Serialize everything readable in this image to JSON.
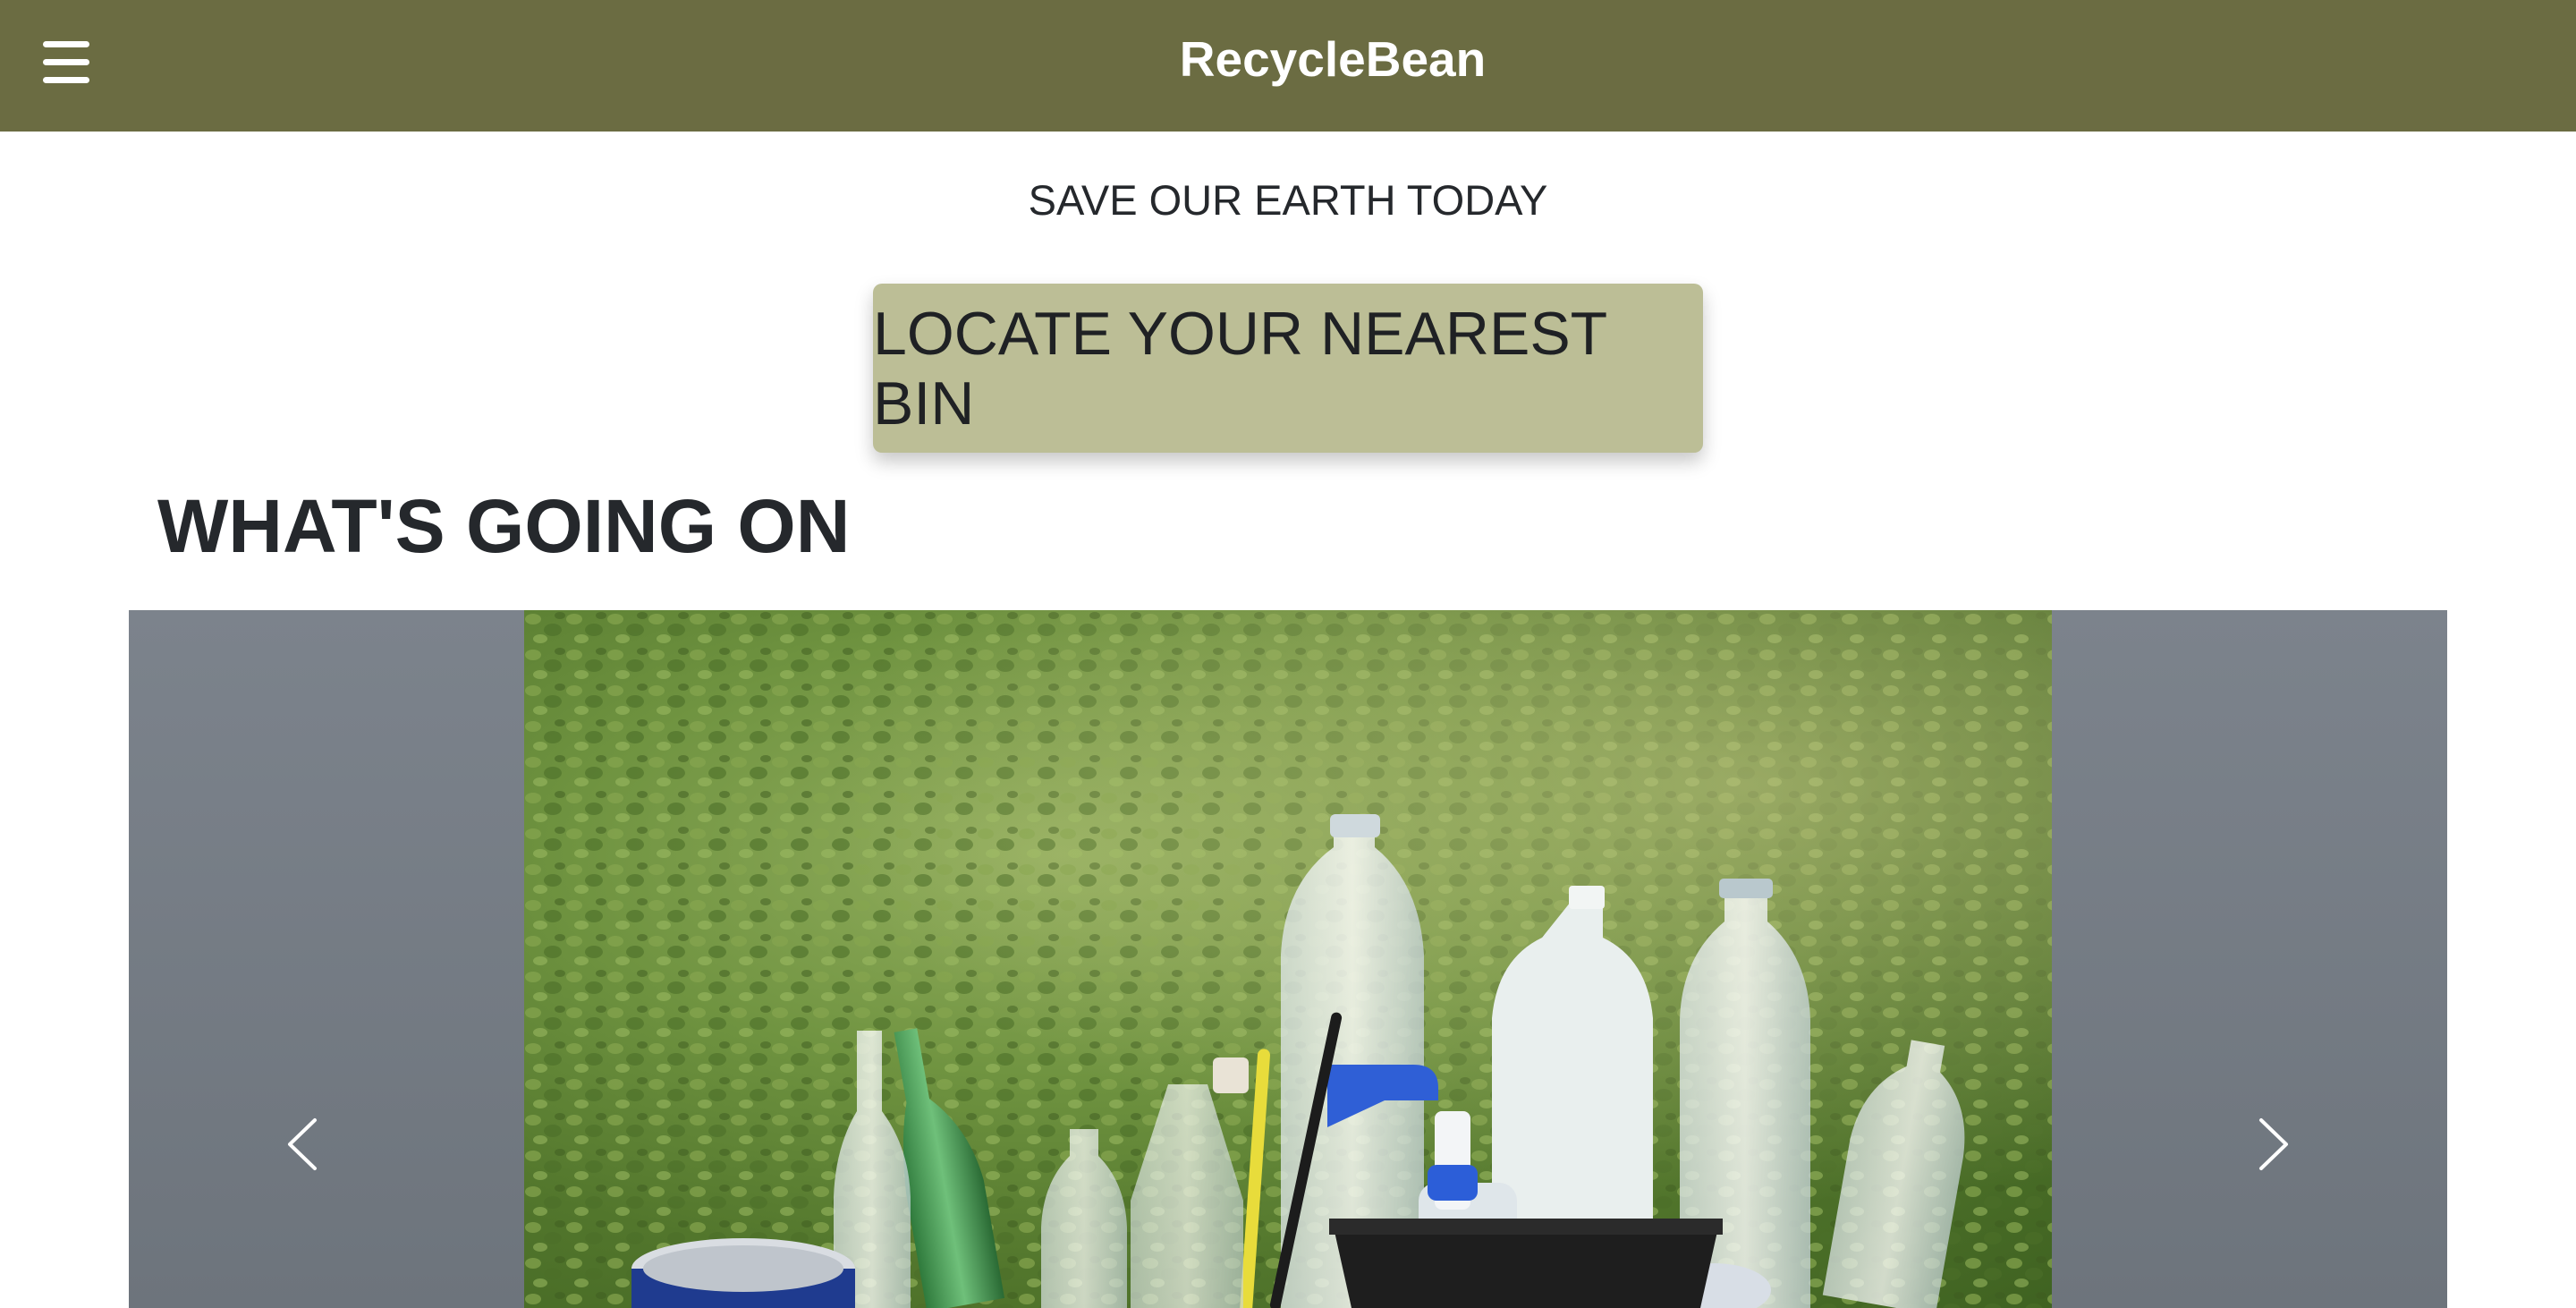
{
  "app": {
    "brand": "RecycleBean"
  },
  "header": {
    "menu_icon": "hamburger-menu-icon"
  },
  "hero": {
    "tagline": "SAVE OUR EARTH TODAY",
    "cta_label": "LOCATE YOUR NEAREST BIN"
  },
  "news": {
    "title": "WHAT'S GOING ON",
    "carousel": {
      "slide_image": "recyclable bottles and cans in bin",
      "prev_icon": "chevron-left-icon",
      "next_icon": "chevron-right-icon"
    }
  },
  "colors": {
    "navbar": "#6b6c42",
    "cta_background": "#bcbe96",
    "carousel_background": "#767d86"
  }
}
